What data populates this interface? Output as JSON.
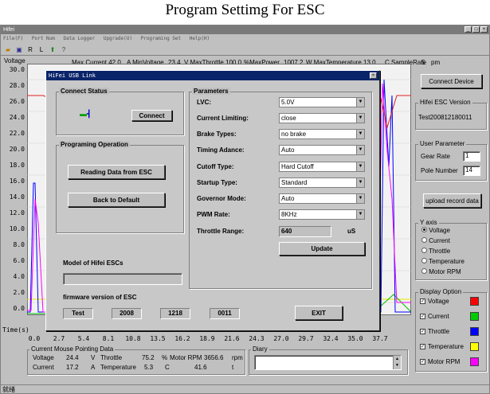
{
  "caption": "Program Settimg For ESC",
  "window": {
    "title": "Hifei",
    "menu": [
      "File(F)",
      "Port Num",
      "Data Logger",
      "Upgrade(U)",
      "Programing Set",
      "Help(H)"
    ]
  },
  "plot": {
    "y_label": "Voltage",
    "x_label": "Time(s)",
    "y_ticks": [
      "30.0",
      "28.0",
      "26.0",
      "24.0",
      "22.0",
      "20.0",
      "18.0",
      "16.0",
      "14.0",
      "12.0",
      "10.0",
      "8.0",
      "6.0",
      "4.0",
      "2.0",
      "0.0"
    ],
    "x_ticks": [
      "0.0",
      "2.7",
      "5.4",
      "8.1",
      "10.8",
      "13.5",
      "16.2",
      "18.9",
      "21.6",
      "24.3",
      "27.0",
      "29.7",
      "32.4",
      "35.0",
      "37.7"
    ],
    "stats": {
      "max_current": "Max Current 42.0",
      "a_min_voltage": "A MinVoltage",
      "min_voltage": "23.4",
      "v_max_throttle": "V MaxThrottle",
      "max_throttle": "100.0",
      "pct_max_power": "%MaxPower",
      "max_power": "1007.2",
      "w_max_temp": "W MaxTemperature 13.0",
      "c_sample_rate": "C SampleRate",
      "sample_rate": "5",
      "pm": "pm"
    }
  },
  "right_panel": {
    "connect_device": "Connect Device",
    "version_legend": "Hifei ESC Version",
    "version_value": "Test200812180011",
    "user_param_legend": "User Parameter",
    "gear_rate_label": "Gear Rate",
    "gear_rate_value": "1",
    "pole_number_label": "Pole Number",
    "pole_number_value": "14",
    "upload_button": "upload record data",
    "y_axis_legend": "Y axis",
    "y_axis_options": [
      "Voltage",
      "Current",
      "Throttle",
      "Temperature",
      "Motor RPM"
    ],
    "display_legend": "Display Option",
    "display_options": [
      {
        "label": "Voltage",
        "color": "#ff0000"
      },
      {
        "label": "Current",
        "color": "#00cc00"
      },
      {
        "label": "Throttle",
        "color": "#0000ff"
      },
      {
        "label": "Temperature",
        "color": "#ffff00"
      },
      {
        "label": "Motor RPM",
        "color": "#ff00ff"
      }
    ]
  },
  "bottom": {
    "mouse_legend": "Current Mouse Pointing Data",
    "voltage_label": "Voltage",
    "voltage_value": "24.4",
    "voltage_unit": "V",
    "throttle_label": "Throttle",
    "throttle_value": "75.2",
    "throttle_unit": "%",
    "rpm_label": "Motor RPM",
    "rpm_value": "3656.6",
    "rpm_unit": "rpm",
    "current_label": "Current",
    "current_value": "17.2",
    "current_unit": "A",
    "temp_label": "Temperature",
    "temp_value": "5.3",
    "temp_unit": "C",
    "t_value": "41.6",
    "t_unit": "t",
    "diary_legend": "Diary",
    "status": "就绪"
  },
  "dialog": {
    "title": "HiFei USB Link",
    "connect_status_legend": "Connect Status",
    "connect_button": "Connect",
    "programing_legend": "Programing Operation",
    "read_button": "Reading Data from ESC",
    "default_button": "Back to Default",
    "model_label": "Model of Hifei ESCs",
    "firmware_label": "firmware version of ESC",
    "firmware": [
      "Test",
      "2008",
      "1218",
      "0011"
    ],
    "exit_button": "EXIT",
    "parameters_legend": "Parameters",
    "params": [
      {
        "label": "LVC:",
        "value": "5.0V"
      },
      {
        "label": "Current Limiting:",
        "value": "close"
      },
      {
        "label": "Brake Types:",
        "value": "no brake"
      },
      {
        "label": "Timing Adance:",
        "value": "Auto"
      },
      {
        "label": "Cutoff Type:",
        "value": "Hard Cutoff"
      },
      {
        "label": "Startup Type:",
        "value": "Standard"
      },
      {
        "label": "Governor Mode:",
        "value": "Auto"
      },
      {
        "label": "PWM Rate:",
        "value": "8KHz"
      }
    ],
    "throttle_range_label": "Throttle Range:",
    "throttle_range_value": "640",
    "throttle_range_unit": "uS",
    "update_button": "Update"
  }
}
